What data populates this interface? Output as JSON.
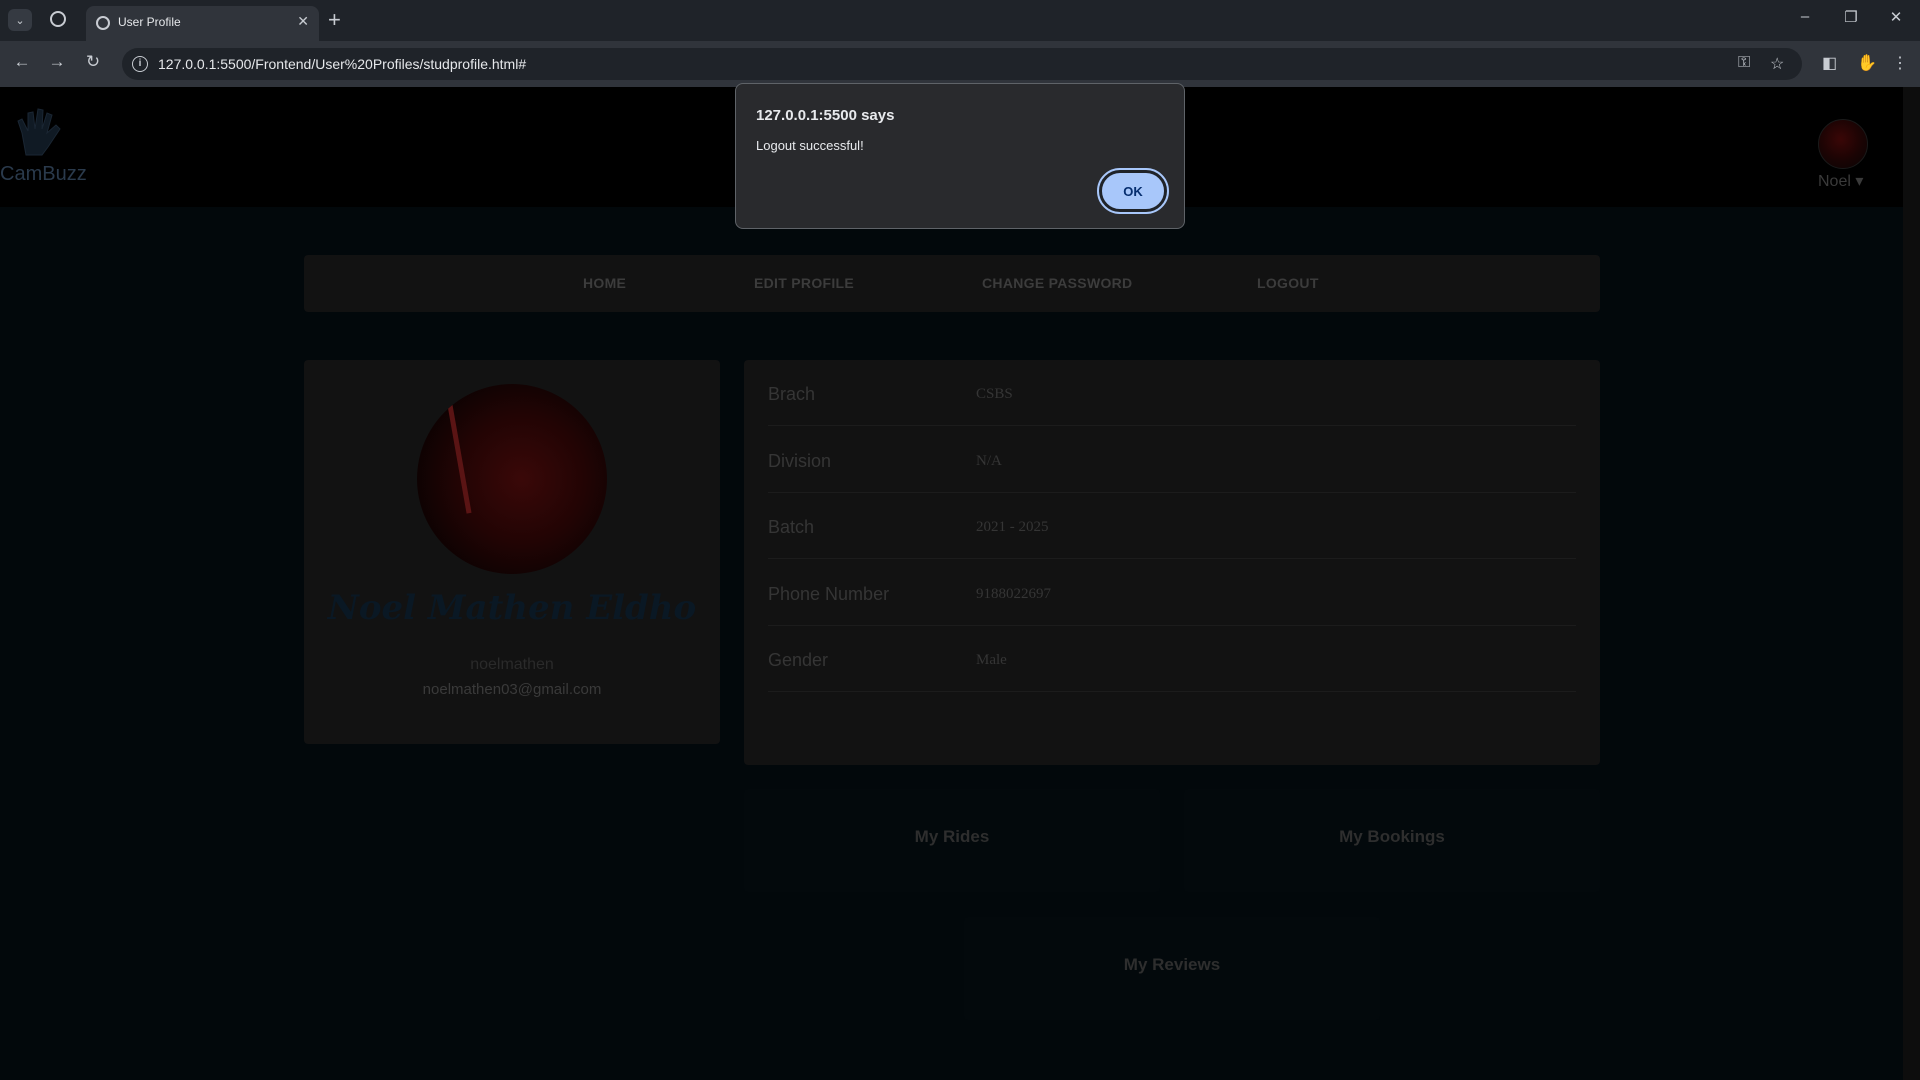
{
  "browser": {
    "tab_title": "User Profile",
    "url": "127.0.0.1:5500/Frontend/User%20Profiles/studprofile.html#",
    "new_tab_glyph": "+",
    "tab_close_glyph": "✕"
  },
  "site": {
    "logo_text": "CamBuzz",
    "user_menu_label": "Noel ▾"
  },
  "nav": {
    "home": "HOME",
    "edit_profile": "EDIT PROFILE",
    "change_password": "CHANGE PASSWORD",
    "logout": "LOGOUT"
  },
  "profile": {
    "full_name": "Noel Mathen Eldho",
    "username": "noelmathen",
    "email": "noelmathen03@gmail.com"
  },
  "details": [
    {
      "label": "Brach",
      "value": "CSBS"
    },
    {
      "label": "Division",
      "value": "N/A"
    },
    {
      "label": "Batch",
      "value": "2021 - 2025"
    },
    {
      "label": "Phone Number",
      "value": "9188022697"
    },
    {
      "label": "Gender",
      "value": "Male"
    }
  ],
  "actions": {
    "my_rides": "My Rides",
    "my_bookings": "My Bookings",
    "my_reviews": "My Reviews"
  },
  "dialog": {
    "title": "127.0.0.1:5500 says",
    "message": "Logout successful!",
    "ok_label": "OK"
  },
  "colors": {
    "dialog_button": "#a8c7fa",
    "dialog_bg": "#292a2d",
    "browser_chrome": "#1f2329"
  }
}
